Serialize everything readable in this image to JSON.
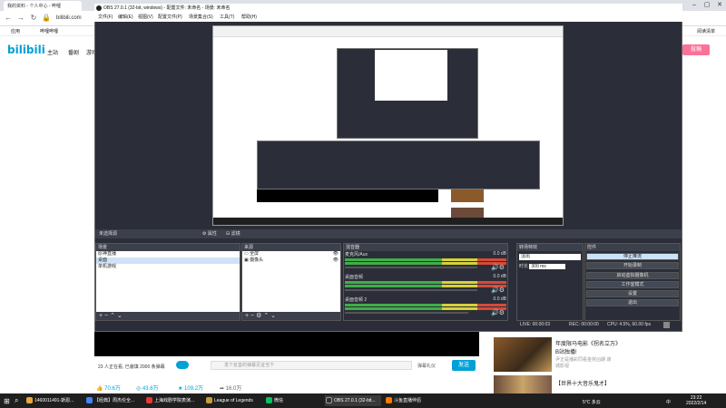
{
  "browser": {
    "tab_title": "我的资料 - 个人中心 - 哔哩",
    "address": "bilibili.com",
    "bookmarks": [
      "应用",
      "哔哩哔哩"
    ],
    "reading_list": "阅读清单"
  },
  "bilibili": {
    "logo": "bilibili",
    "nav": [
      "主站",
      "番剧",
      "游戏"
    ],
    "submit_button": "投稿"
  },
  "obs": {
    "title": "OBS 27.0.1 (32-bit, windows) - 配置文件: 未命名 - 场景: 未命名",
    "menus": [
      "文件(F)",
      "编辑(E)",
      "视图(V)",
      "配置文件(P)",
      "场景集合(S)",
      "工具(T)",
      "帮助(H)"
    ],
    "no_source_selected": "未选择源",
    "properties": "属性",
    "filters": "滤镜",
    "scenes_title": "场景",
    "scenes": [
      "原神直播",
      "桌面",
      "单机游戏"
    ],
    "sources_title": "来源",
    "sources": [
      "全屏",
      "摄像头"
    ],
    "mixer_title": "混音器",
    "mixer_tracks": [
      {
        "name": "麦克风/Aux",
        "db": "0.0 dB"
      },
      {
        "name": "桌面音频",
        "db": "0.0 dB"
      },
      {
        "name": "桌面音频 2",
        "db": "0.0 dB"
      }
    ],
    "transitions_title": "转场特效",
    "transition_value": "淡出",
    "duration_label": "时长",
    "duration_value": "300 ms",
    "controls_title": "控件",
    "controls": [
      "停止推流",
      "开始录制",
      "启动虚拟摄像机",
      "工作室模式",
      "设置",
      "退出"
    ],
    "status": {
      "live": "LIVE: 00:00:03",
      "rec": "REC: 00:00:00",
      "cpu": "CPU: 4.5%, 60.00 fps"
    }
  },
  "player": {
    "viewers": "23 人正在看, 已装填 2000 条弹幕",
    "danmaku_placeholder": "发个友善的弹幕见证当下",
    "danmaku_etiquette": "弹幕礼仪",
    "send": "发送",
    "likes": "70.6万",
    "coins": "43.6万",
    "favorites": "109.2万",
    "shares": "16.0万"
  },
  "recommendations": [
    {
      "title": "年度限马电影《拐名立万》",
      "subtitle": "B站独播!",
      "meta": "尹正是播彩同看金奖凶期 谋",
      "meta2": "城影视"
    },
    {
      "title": "【世界十大音乐鬼才】"
    }
  ],
  "taskbar": {
    "items": [
      "1460011491-斯恩...",
      "【经典】周杰伦全...",
      "上海戏剧学院表演...",
      "League of Legends",
      "微信",
      "OBS 27.0.1 (32-bit...",
      "斗鱼直播伴侣"
    ],
    "weather": "5°C 多云",
    "ime": "中",
    "time": "23:22",
    "date": "2022/2/14"
  }
}
